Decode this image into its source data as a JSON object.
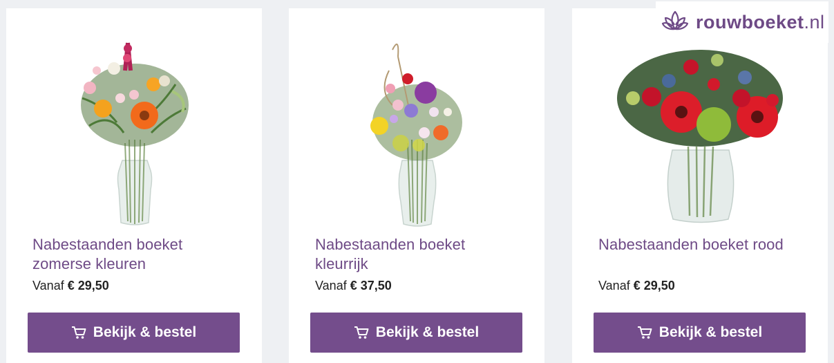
{
  "logo": {
    "brand": "rouwboeket",
    "tld": ".nl",
    "icon": "lotus-icon"
  },
  "colors": {
    "accent": "#744d8c",
    "title": "#6e4a86",
    "background": "#eef0f3"
  },
  "products": [
    {
      "title": "Nabestaanden boeket zomerse kleuren",
      "price_prefix": "Vanaf",
      "price": "€ 29,50",
      "button_label": "Bekijk & bestel",
      "button_icon": "cart-icon",
      "image": "mixed-summer-bouquet-image"
    },
    {
      "title": "Nabestaanden boeket kleurrijk",
      "price_prefix": "Vanaf",
      "price": "€ 37,50",
      "button_label": "Bekijk & bestel",
      "button_icon": "cart-icon",
      "image": "colorful-bouquet-image"
    },
    {
      "title": "Nabestaanden boeket rood",
      "price_prefix": "Vanaf",
      "price": "€ 29,50",
      "button_label": "Bekijk & bestel",
      "button_icon": "cart-icon",
      "image": "red-bouquet-image"
    }
  ]
}
